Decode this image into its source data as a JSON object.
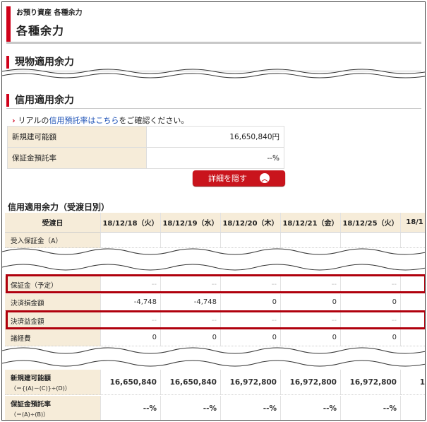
{
  "header": {
    "breadcrumb": "お預り資産 各種余力",
    "title": "各種余力"
  },
  "cash_section": {
    "title": "現物適用余力"
  },
  "margin_section": {
    "title": "信用適用余力",
    "note_prefix": "リアルの",
    "note_link": "信用預託率はこちら",
    "note_suffix": "をご確認ください。",
    "summary": [
      {
        "label": "新規建可能額",
        "value": "16,650,840円"
      },
      {
        "label": "保証金預託率",
        "value": "--%"
      }
    ],
    "toggle_button": "詳細を隠す"
  },
  "by_date": {
    "title": "信用適用余力（受渡日別）",
    "corner": "受渡日",
    "dates": [
      "18/12/18（火）",
      "18/12/19（水）",
      "18/12/20（木）",
      "18/12/21（金）",
      "18/12/25（火）",
      "18/1"
    ],
    "rows": {
      "received_margin": {
        "label": "受入保証金（A）"
      },
      "margin_planned": {
        "label": "保証金（予定）",
        "values": [
          "--",
          "--",
          "--",
          "--",
          "--"
        ]
      },
      "settle_loss": {
        "label": "決済損金額",
        "values": [
          "-4,748",
          "-4,748",
          "0",
          "0",
          "0"
        ]
      },
      "settle_profit": {
        "label": "決済益金額",
        "values": [
          "--",
          "--",
          "--",
          "--",
          "--"
        ]
      },
      "fees": {
        "label": "諸経費",
        "values": [
          "0",
          "0",
          "0",
          "0",
          "0"
        ]
      },
      "new_position": {
        "label": "新規建可能額",
        "formula": "（＝{(A)－(C)}÷(D)）",
        "values": [
          "16,650,840",
          "16,650,840",
          "16,972,800",
          "16,972,800",
          "16,972,800",
          "1"
        ]
      },
      "deposit_rate": {
        "label": "保証金預託率",
        "formula": "（＝(A)÷(B)）",
        "values": [
          "--%",
          "--%",
          "--%",
          "--%",
          "--%",
          ""
        ]
      }
    }
  }
}
